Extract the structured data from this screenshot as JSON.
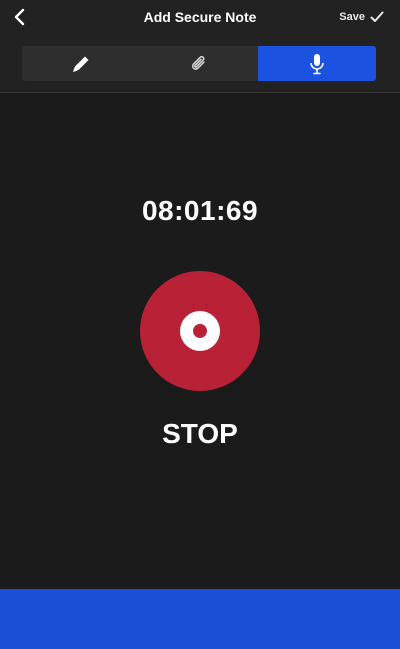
{
  "header": {
    "title": "Add Secure Note",
    "save_label": "Save"
  },
  "tabs": [
    {
      "icon": "pencil-icon",
      "active": false
    },
    {
      "icon": "paperclip-icon",
      "active": false
    },
    {
      "icon": "microphone-icon",
      "active": true
    }
  ],
  "recorder": {
    "timer": "08:01:69",
    "stop_label": "STOP"
  },
  "colors": {
    "background": "#1b1b1c",
    "header": "#222223",
    "accent_blue": "#1b52e0",
    "record_red": "#b82136"
  }
}
